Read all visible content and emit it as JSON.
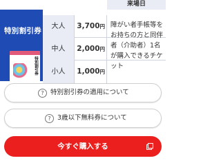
{
  "table": {
    "header_right": "来場日",
    "ticket_type": "特別割引券",
    "ticket_image_label": "特別割引券",
    "rows": [
      {
        "age": "大人",
        "price": "3,700",
        "unit": "円"
      },
      {
        "age": "中人",
        "price": "2,000",
        "unit": "円"
      },
      {
        "age": "小人",
        "price": "1,000",
        "unit": "円"
      }
    ],
    "note": "障がい者手帳等をお持ちの方と同伴者（介助者）1名が購入できるチケット"
  },
  "buttons": {
    "discount_info": "特別割引券の適用について",
    "free_ticket_info": "3歳以下無料券について",
    "buy_now": "今すぐ購入する"
  },
  "colors": {
    "accent_blue": "#1f4bb4",
    "buy_red": "#ec1f1f",
    "header_tint": "#e9ebf5"
  },
  "icons": {
    "question": "question-circle-icon",
    "external": "external-link-icon"
  }
}
